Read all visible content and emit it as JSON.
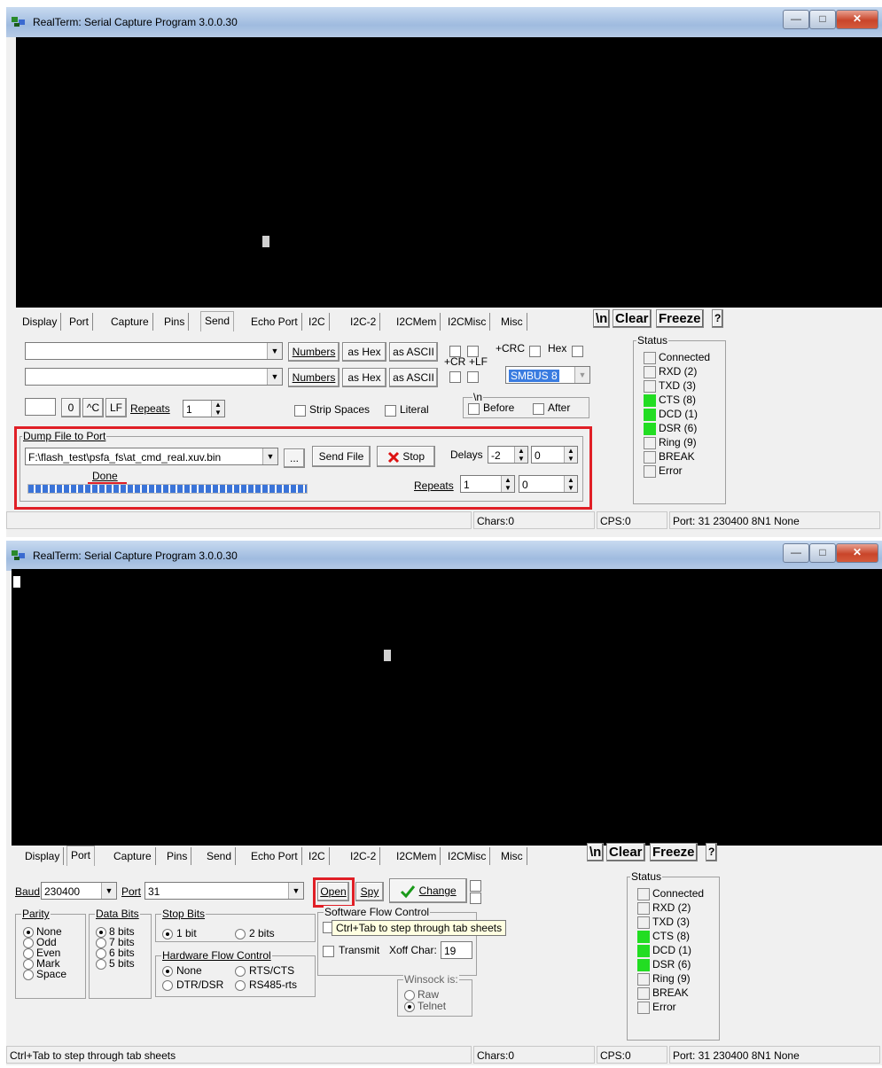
{
  "top_window": {
    "title": "RealTerm: Serial Capture Program 3.0.0.30",
    "tabs": [
      "Display",
      "Port",
      "Capture",
      "Pins",
      "Send",
      "Echo Port",
      "I2C",
      "I2C-2",
      "I2CMem",
      "I2CMisc",
      "Misc"
    ],
    "active_tab": "Send",
    "toolbar": {
      "newline": "\\n",
      "clear": "Clear",
      "freeze": "Freeze",
      "help": "?"
    },
    "send": {
      "numbers_label": "Numbers",
      "as_hex_label": "as Hex",
      "as_ascii_label": "as ASCII",
      "cr_label": "+CR",
      "lf_label": "+LF",
      "crc_label": "+CRC",
      "hex_label": "Hex",
      "smbus_value": "SMBUS 8",
      "zero_label": "0",
      "ctrl_c_label": "^C",
      "lf_btn_label": "LF",
      "repeats_label": "Repeats",
      "repeats_value": "1",
      "strip_spaces_label": "Strip Spaces",
      "literal_label": "Literal",
      "newline_group": "\\n",
      "before_label": "Before",
      "after_label": "After"
    },
    "dump": {
      "group_label": "Dump File to Port",
      "file_path": "F:\\flash_test\\psfa_fs\\at_cmd_real.xuv.bin",
      "browse_label": "...",
      "send_file_label": "Send File",
      "stop_label": "Stop",
      "delays_label": "Delays",
      "delay1": "-2",
      "delay2": "0",
      "repeats_label": "Repeats",
      "repeats1": "1",
      "repeats2": "0",
      "progress_text": "Done",
      "progress": 1.0
    },
    "status": {
      "title": "Status",
      "items": [
        {
          "label": "Connected",
          "on": false
        },
        {
          "label": "RXD (2)",
          "on": false
        },
        {
          "label": "TXD (3)",
          "on": false
        },
        {
          "label": "CTS (8)",
          "on": true
        },
        {
          "label": "DCD (1)",
          "on": true
        },
        {
          "label": "DSR (6)",
          "on": true
        },
        {
          "label": "Ring (9)",
          "on": false
        },
        {
          "label": "BREAK",
          "on": false
        },
        {
          "label": "Error",
          "on": false
        }
      ]
    },
    "statusbar": {
      "message": "",
      "chars": "Chars:0",
      "cps": "CPS:0",
      "port": "Port: 31  230400 8N1 None"
    }
  },
  "bottom_window": {
    "title": "RealTerm: Serial Capture Program 3.0.0.30",
    "tabs": [
      "Display",
      "Port",
      "Capture",
      "Pins",
      "Send",
      "Echo Port",
      "I2C",
      "I2C-2",
      "I2CMem",
      "I2CMisc",
      "Misc"
    ],
    "active_tab": "Port",
    "toolbar": {
      "newline": "\\n",
      "clear": "Clear",
      "freeze": "Freeze",
      "help": "?"
    },
    "port": {
      "baud_label": "Baud",
      "baud_value": "230400",
      "port_label": "Port",
      "port_value": "31",
      "open_label": "Open",
      "spy_label": "Spy",
      "change_label": "Change",
      "parity_label": "Parity",
      "parity_options": [
        "None",
        "Odd",
        "Even",
        "Mark",
        "Space"
      ],
      "parity_selected": "None",
      "databits_label": "Data Bits",
      "databits_options": [
        "8 bits",
        "7 bits",
        "6 bits",
        "5 bits"
      ],
      "databits_selected": "8 bits",
      "stopbits_label": "Stop Bits",
      "stopbits_options": [
        "1 bit",
        "2 bits"
      ],
      "stopbits_selected": "1 bit",
      "hwflow_label": "Hardware Flow Control",
      "hwflow_options": [
        "None",
        "RTS/CTS",
        "DTR/DSR",
        "RS485-rts"
      ],
      "hwflow_selected": "None",
      "swflow_label": "Software Flow Control",
      "transmit_label": "Transmit",
      "xoff_label": "Xoff Char:",
      "xoff_value": "19",
      "winsock_label": "Winsock is:",
      "winsock_options": [
        "Raw",
        "Telnet"
      ],
      "winsock_selected": "Telnet",
      "tooltip": "Ctrl+Tab to step through tab sheets"
    },
    "status": {
      "title": "Status",
      "items": [
        {
          "label": "Connected",
          "on": false
        },
        {
          "label": "RXD (2)",
          "on": false
        },
        {
          "label": "TXD (3)",
          "on": false
        },
        {
          "label": "CTS (8)",
          "on": true
        },
        {
          "label": "DCD (1)",
          "on": true
        },
        {
          "label": "DSR (6)",
          "on": true
        },
        {
          "label": "Ring (9)",
          "on": false
        },
        {
          "label": "BREAK",
          "on": false
        },
        {
          "label": "Error",
          "on": false
        }
      ]
    },
    "statusbar": {
      "message": "Ctrl+Tab to step through tab sheets",
      "chars": "Chars:0",
      "cps": "CPS:0",
      "port": "Port: 31  230400 8N1 None"
    }
  },
  "colors": {
    "highlight": "#e01f26",
    "led_on": "#22dd22",
    "progress": "#3b74d8",
    "terminal": "#000000"
  }
}
